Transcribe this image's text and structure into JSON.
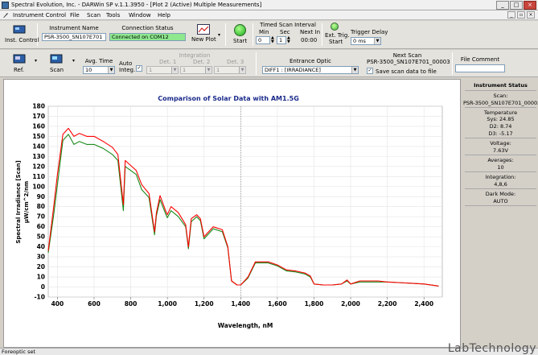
{
  "window": {
    "title": "Spectral Evolution, Inc. - DARWin SP v.1.1.3950 - [Plot 2 (Active) Multiple Measurements]",
    "minimize": "_",
    "maximize": "□",
    "close": "×"
  },
  "menu": [
    "Instrument Control",
    "File",
    "Scan",
    "Tools",
    "Window",
    "Help"
  ],
  "mdi_buttons": [
    "_",
    "▫",
    "×"
  ],
  "toolbar": {
    "inst_control_label": "Inst. Control",
    "instrument_name_label": "Instrument Name",
    "instrument_name_value": "PSR-3500_SN107E701",
    "connection_status_label": "Connection Status",
    "connection_status_value": "Connected on COM12",
    "new_plot_label": "New Plot",
    "start_label": "Start",
    "timed_scan_label": "Timed Scan Interval",
    "min_label": "Min",
    "sec_label": "Sec",
    "next_in_label": "Next In",
    "min_value": "0",
    "sec_value": "1",
    "next_in_value": "00:00",
    "ext_trig_label": "Ext. Trig.",
    "ext_trig_start": "Start",
    "trigger_delay_label": "Trigger Delay",
    "trigger_delay_value": "0 ms",
    "ref_label": "Ref.",
    "scan_label": "Scan",
    "avg_time_label": "Avg. Time",
    "avg_time_value": "10",
    "auto_integ_label_1": "Auto",
    "auto_integ_label_2": "Integ.",
    "integration_label": "Integration",
    "det1_label": "Det. 1",
    "det2_label": "Det. 2",
    "det3_label": "Det. 3",
    "det1_value": "1",
    "det2_value": "1",
    "det3_value": "1",
    "entrance_optic_label": "Entrance Optic",
    "entrance_optic_value": "DIFF1 : [IRRADIANCE]",
    "next_scan_label": "Next Scan",
    "next_scan_value": "PSR-3500_SN107E701_00003",
    "save_scan_label": "Save scan data to file",
    "file_comment_label": "File Comment"
  },
  "status": {
    "header": "Instrument Status",
    "scan_label": "Scan:",
    "scan_value": "PSR-3500_SN107E701_00002",
    "temperature_label": "Temperature",
    "sys_temp": "Sys: 24.85",
    "d2_temp": "D2: 8.74",
    "d3_temp": "D3: -5.17",
    "voltage_label": "Voltage:",
    "voltage_value": "7.63V",
    "averages_label": "Averages:",
    "averages_value": "10",
    "integration_label": "Integration:",
    "integration_value": "4,8,6",
    "dark_mode_label": "Dark Mode:",
    "dark_mode_value": "AUTO"
  },
  "statusbar_text": "Foreoptic set",
  "watermark": "LabTechnology",
  "colors": {
    "red_series": "#ff0000",
    "green_series": "#1a8a1a",
    "title_blue": "#1a2a8a"
  },
  "chart_data": {
    "type": "line",
    "title": "Comparison of Solar Data with AM1.5G",
    "xlabel": "Wavelength, nM",
    "ylabel_line1": "Spectral Irradiance [Scan]",
    "ylabel_line2": "µW/cm^2/nm",
    "xlim": [
      350,
      2500
    ],
    "ylim": [
      -10,
      180
    ],
    "xticks": [
      400,
      600,
      800,
      1000,
      1200,
      1400,
      1600,
      1800,
      2000,
      2200,
      2400
    ],
    "xtick_labels": [
      "400",
      "600",
      "800",
      "1,000",
      "1,200",
      "1,400",
      "1,600",
      "1,800",
      "2,000",
      "2,200",
      "2,400"
    ],
    "yticks": [
      -10,
      0,
      10,
      20,
      30,
      40,
      50,
      60,
      70,
      80,
      90,
      100,
      110,
      120,
      130,
      140,
      150,
      160,
      170,
      180
    ],
    "x": [
      350,
      380,
      400,
      430,
      460,
      490,
      520,
      560,
      600,
      650,
      700,
      730,
      760,
      770,
      800,
      830,
      860,
      900,
      930,
      940,
      960,
      990,
      1000,
      1020,
      1060,
      1100,
      1115,
      1130,
      1160,
      1180,
      1200,
      1250,
      1300,
      1330,
      1350,
      1380,
      1400,
      1440,
      1480,
      1550,
      1600,
      1650,
      1700,
      1750,
      1780,
      1800,
      1850,
      1900,
      1950,
      1980,
      2000,
      2050,
      2100,
      2150,
      2200,
      2300,
      2400,
      2480
    ],
    "series": [
      {
        "values": [
          36,
          80,
          112,
          152,
          158,
          150,
          153,
          150,
          150,
          145,
          139,
          132,
          82,
          126,
          121,
          116,
          102,
          93,
          55,
          74,
          91,
          76,
          72,
          80,
          74,
          62,
          40,
          68,
          72,
          68,
          50,
          60,
          57,
          40,
          6,
          2,
          2,
          10,
          25,
          25,
          22,
          17,
          16,
          14,
          11,
          3,
          2,
          2,
          3,
          7,
          3,
          6,
          6,
          6,
          5,
          4,
          3,
          1
        ]
      },
      {
        "values": [
          34,
          72,
          102,
          146,
          152,
          142,
          145,
          142,
          142,
          138,
          132,
          126,
          76,
          120,
          116,
          112,
          97,
          89,
          52,
          71,
          87,
          73,
          69,
          76,
          70,
          60,
          38,
          65,
          70,
          66,
          48,
          58,
          55,
          39,
          6,
          2,
          2,
          9,
          24,
          24,
          21,
          16,
          15,
          13,
          10,
          3,
          2,
          2,
          3,
          6,
          3,
          5,
          5,
          5,
          5,
          4,
          3,
          1
        ]
      }
    ],
    "grid": true,
    "vline_at": 1400
  }
}
